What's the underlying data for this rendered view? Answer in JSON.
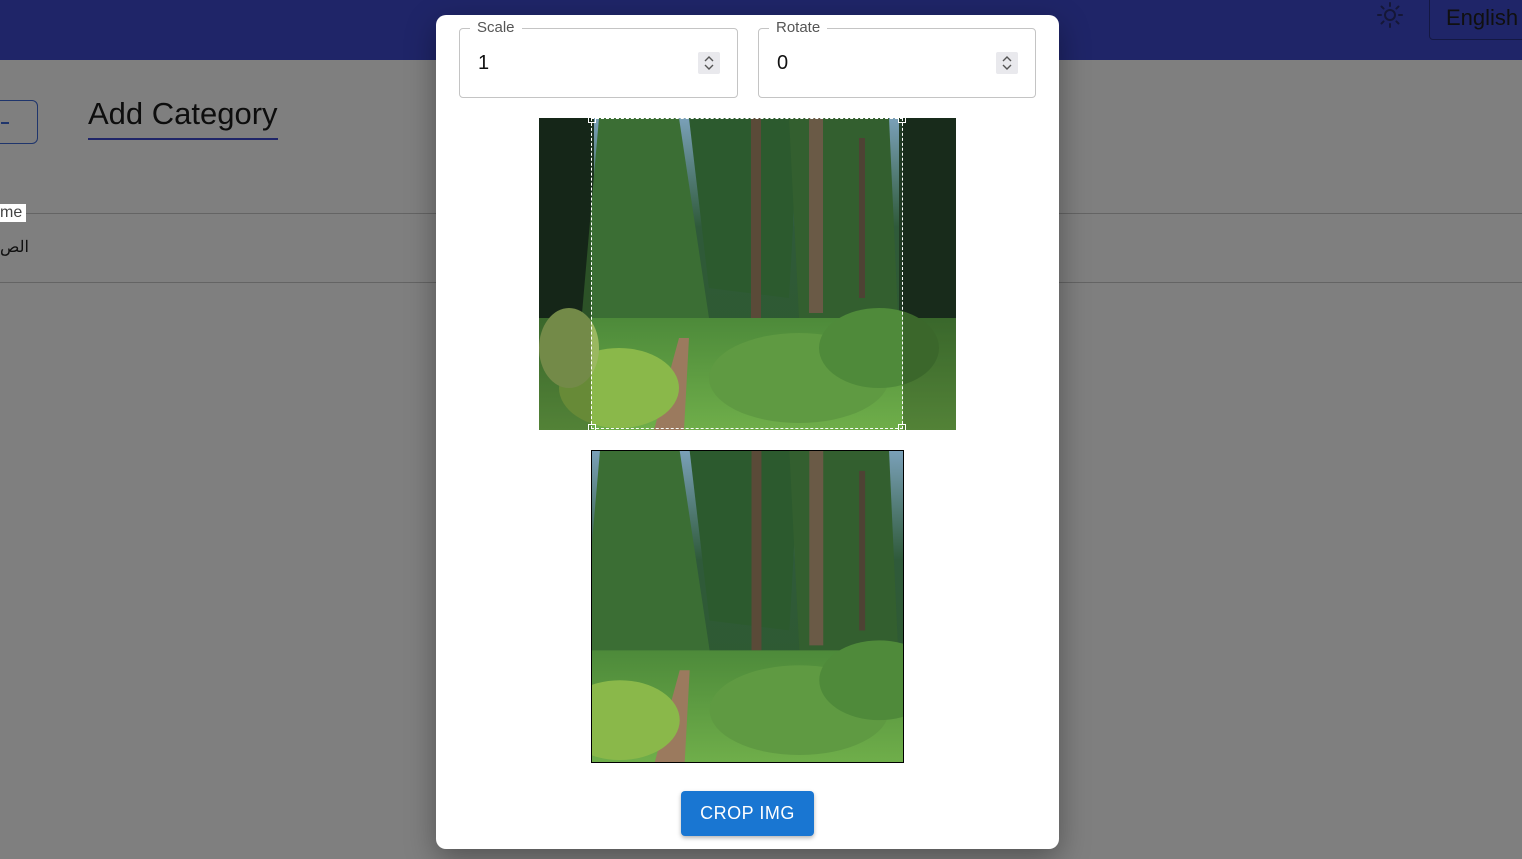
{
  "colors": {
    "primary": "#3f4ad0",
    "primary_light": "#3f6bd8",
    "button": "#1976d2"
  },
  "header": {
    "theme_icon": "sun-icon",
    "language": "English"
  },
  "page": {
    "back_icon": "arrow-left-icon",
    "title": "Add Category",
    "name_field": {
      "label": "me",
      "value": "الص"
    }
  },
  "crop_dialog": {
    "scale": {
      "label": "Scale",
      "value": "1"
    },
    "rotate": {
      "label": "Rotate",
      "value": "0"
    },
    "image": "forest-path-photo",
    "crop_button": "CROP IMG"
  }
}
